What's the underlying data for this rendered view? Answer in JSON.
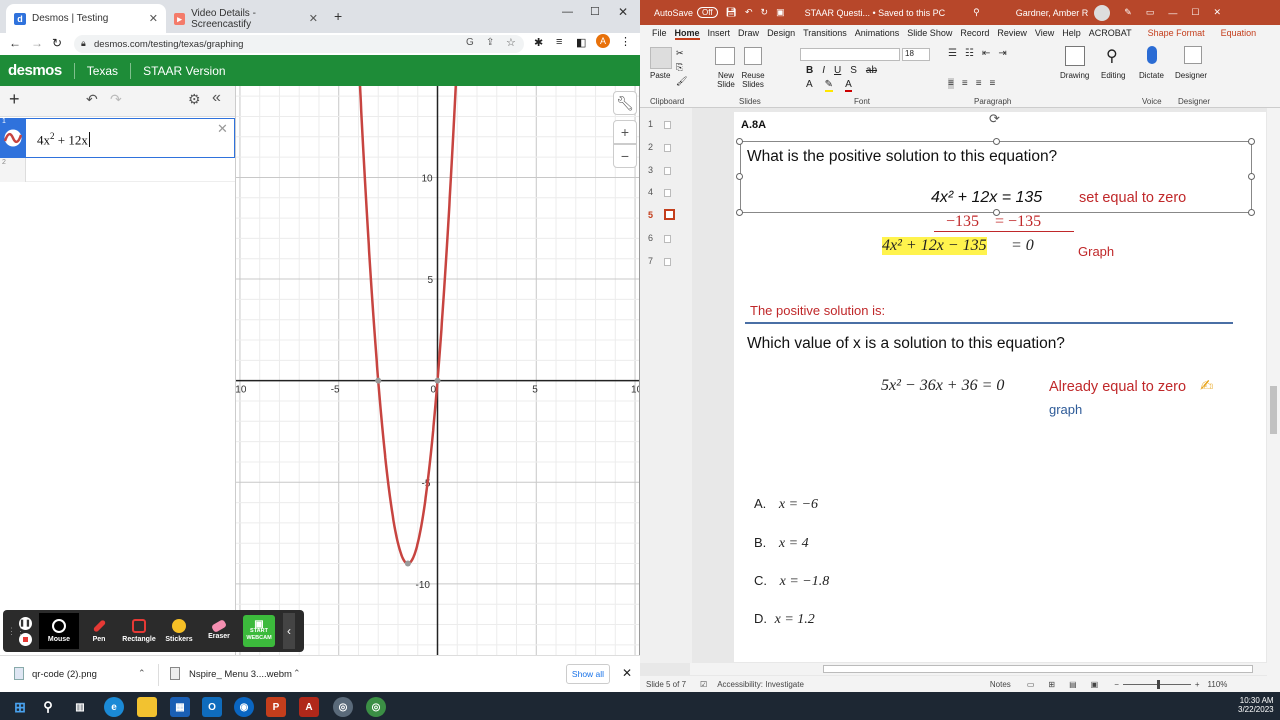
{
  "chrome": {
    "tabs": [
      {
        "label": "Desmos | Testing",
        "icon": "desmos-favicon"
      },
      {
        "label": "Video Details - Screencastify",
        "icon": "screencastify-favicon"
      }
    ],
    "url": "desmos.com/testing/texas/graphing",
    "profile_initial": "A"
  },
  "desmos": {
    "logo": "desmos",
    "region": "Texas",
    "version": "STAAR Version",
    "expressions": [
      {
        "num": "1",
        "latex_base": "4x",
        "latex_exp": "2",
        "latex_rest": " + 12x"
      },
      {
        "num": "2"
      }
    ],
    "graph": {
      "x_ticks": [
        "-10",
        "-5",
        "0",
        "5",
        "10"
      ],
      "y_ticks": [
        "10",
        "5",
        "-5",
        "-10"
      ],
      "curve_color": "#c74440",
      "equation": {
        "a": 4,
        "b": 12,
        "c": 0
      },
      "xlim": [
        -10.2,
        10.2
      ],
      "ylim": [
        -13.5,
        14.5
      ]
    }
  },
  "screencastify": {
    "tools": [
      "Mouse",
      "Pen",
      "Rectangle",
      "Stickers",
      "Eraser"
    ],
    "webcam_line1": "START",
    "webcam_line2": "WEBCAM"
  },
  "downloads": {
    "items": [
      "qr-code (2).png",
      "Nspire_ Menu 3....webm"
    ],
    "show_all": "Show all"
  },
  "taskbar": {
    "time": "10:30 AM",
    "date": "3/22/2023"
  },
  "ppt": {
    "autosave": "AutoSave",
    "autosave_state": "Off",
    "doc_title": "STAAR Questi... • Saved to this PC",
    "user": "Gardner, Amber R",
    "menu": [
      "File",
      "Home",
      "Insert",
      "Draw",
      "Design",
      "Transitions",
      "Animations",
      "Slide Show",
      "Record",
      "Review",
      "View",
      "Help",
      "ACROBAT",
      "Shape Format",
      "Equation"
    ],
    "ribbon_groups": [
      "Clipboard",
      "Slides",
      "Font",
      "Paragraph",
      "Voice",
      "Designer"
    ],
    "ribbon_buttons": [
      "Paste",
      "New Slide",
      "Reuse Slides",
      "Drawing",
      "Editing",
      "Dictate",
      "Designer"
    ],
    "font_size": "18",
    "thumb_nums": [
      "1",
      "2",
      "3",
      "4",
      "5",
      "6",
      "7"
    ],
    "status_slide": "Slide 5 of 7",
    "status_access": "Accessibility: Investigate",
    "notes": "Notes",
    "zoom": "110%"
  },
  "slide": {
    "tag": "A.8A",
    "q1": "What is the positive solution to this equation?",
    "eq1": "4x² + 12x = 135",
    "eq1_note": "set equal to zero",
    "eq1_sub": "−135    = −135",
    "eq2_highlight": "4x² + 12x − 135",
    "eq2_rest": " = 0",
    "eq2_note": "Graph",
    "positive_label": "The positive solution is:",
    "q2": "Which value of x is a solution to this equation?",
    "eq3": "5x² − 36x + 36 = 0",
    "eq3_note": "Already equal to zero",
    "eq3_note2": "graph",
    "choices": [
      {
        "letter": "A.",
        "value": "x = −6"
      },
      {
        "letter": "B.",
        "value": "x = 4"
      },
      {
        "letter": "C.",
        "value": "x = −1.8"
      },
      {
        "letter": "D.",
        "value": "x = 1.2"
      }
    ]
  }
}
